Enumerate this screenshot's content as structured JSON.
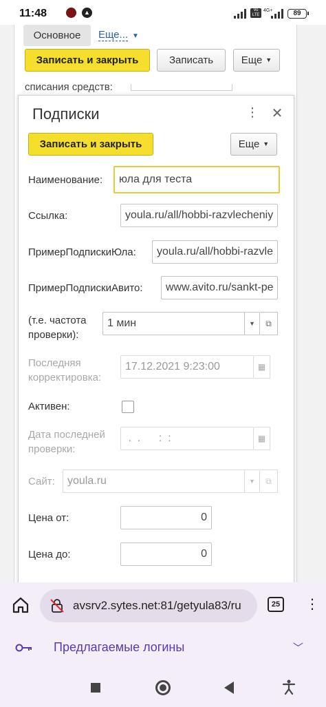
{
  "status_bar": {
    "time": "11:48",
    "network_label": "4G+",
    "volte_label": "Vo LTE",
    "battery": "89"
  },
  "background_form": {
    "tab_main": "Основное",
    "tab_more": "Еще...",
    "save_close": "Записать и закрыть",
    "save": "Записать",
    "more": "Еще",
    "partial_label": "списания средств:"
  },
  "dialog": {
    "title": "Подписки",
    "save_close": "Записать и закрыть",
    "more": "Еще",
    "fields": {
      "name_label": "Наименование:",
      "name_value": "юла для теста",
      "link_label": "Ссылка:",
      "link_value": "youla.ru/all/hobbi-razvlecheniy",
      "example_yula_label": "ПримерПодпискиЮла:",
      "example_yula_value": "youla.ru/all/hobbi-razvle",
      "example_avito_label": "ПримерПодпискиАвито:",
      "example_avito_value": "www.avito.ru/sankt-pe",
      "freq_label": "(т.е. частота проверки):",
      "freq_value": "1 мин",
      "last_edit_label": "Последняя корректировка:",
      "last_edit_value": "17.12.2021  9:23:00",
      "active_label": "Активен:",
      "active_checked": false,
      "last_check_label": "Дата последней проверки:",
      "last_check_value": " .  .      :  :",
      "site_label": "Сайт:",
      "site_value": "youla.ru",
      "price_from_label": "Цена от:",
      "price_from_value": "0",
      "price_to_label": "Цена до:",
      "price_to_value": "0"
    }
  },
  "browser": {
    "url": "avsrv2.sytes.net:81/getyula83/ru",
    "tab_count": "25",
    "suggestion": "Предлагаемые логины"
  },
  "colors": {
    "accent_yellow": "#f5df2c",
    "focus_border": "#f0c63a",
    "link_blue": "#2c5fb3",
    "suggestion_purple": "#5a3aa8",
    "browser_bar": "#f4eef8"
  }
}
